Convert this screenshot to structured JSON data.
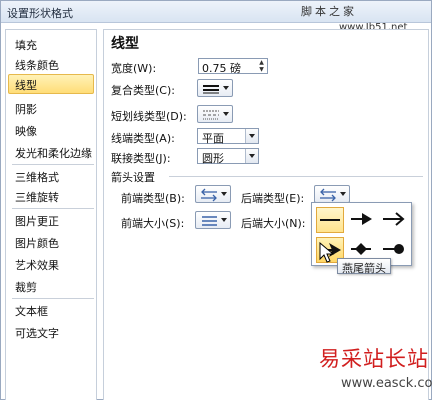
{
  "dialog": {
    "title": "设置形状格式"
  },
  "watermark": {
    "brand": "脚本之家",
    "url": "www.Jb51.net",
    "site": "易采站长站",
    "site_url": "www.easck.com"
  },
  "sidebar": {
    "items": [
      {
        "label": "填充"
      },
      {
        "label": "线条颜色"
      },
      {
        "label": "线型",
        "selected": true
      },
      {
        "label": "阴影"
      },
      {
        "label": "映像"
      },
      {
        "label": "发光和柔化边缘"
      },
      {
        "label": "三维格式"
      },
      {
        "label": "三维旋转"
      },
      {
        "label": "图片更正"
      },
      {
        "label": "图片颜色"
      },
      {
        "label": "艺术效果"
      },
      {
        "label": "裁剪"
      },
      {
        "label": "文本框"
      },
      {
        "label": "可选文字"
      }
    ]
  },
  "main": {
    "section_title": "线型",
    "width": {
      "label": "宽度(W):",
      "value": "0.75 磅"
    },
    "compound": {
      "label": "复合类型(C):"
    },
    "dash": {
      "label": "短划线类型(D):"
    },
    "cap": {
      "label": "线端类型(A):",
      "value": "平面"
    },
    "join": {
      "label": "联接类型(J):",
      "value": "圆形"
    },
    "arrows": {
      "heading": "箭头设置",
      "begin_type": {
        "label": "前端类型(B):"
      },
      "end_type": {
        "label": "后端类型(E):"
      },
      "begin_size": {
        "label": "前端大小(S):"
      },
      "end_size": {
        "label": "后端大小(N):"
      }
    }
  },
  "palette": {
    "tooltip": "燕尾箭头",
    "options": [
      "无箭头",
      "箭头",
      "开放型箭头",
      "燕尾箭头",
      "菱形箭头",
      "圆型箭头"
    ],
    "hover_index": 3,
    "selected_index": 0
  },
  "colors": {
    "accent": "#ffdd78",
    "accent_border": "#e6b94c",
    "border": "#8a9bb4",
    "watermark_red": "#d11f1f"
  }
}
